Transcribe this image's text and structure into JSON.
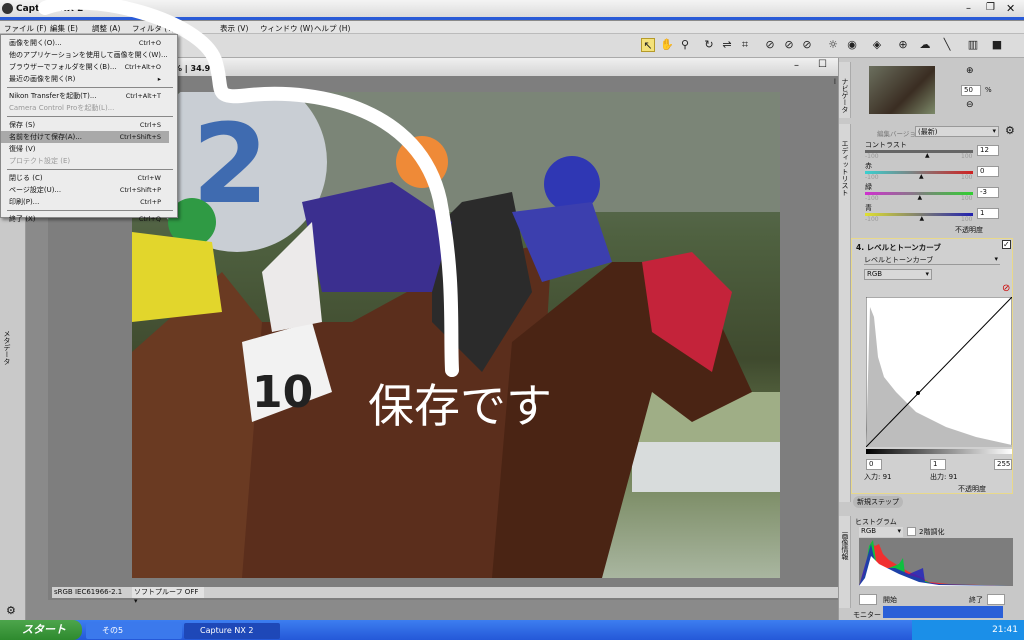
{
  "app": {
    "title": "Capture NX 2",
    "logo": "nx-logo-icon"
  },
  "menubar": [
    "ファイル (F)",
    "編集 (E)",
    "調整 (A)",
    "フィルタ (T)",
    "表示 (V)",
    "ウィンドウ (W)",
    "ヘルプ (H)"
  ],
  "file_menu": [
    {
      "label": "画像を開く(O)...",
      "shortcut": "Ctrl+O"
    },
    {
      "label": "他のアプリケーションを使用して画像を開く(W)...",
      "shortcut": ""
    },
    {
      "label": "ブラウザーでフォルダを開く(B)...",
      "shortcut": "Ctrl+Alt+O"
    },
    {
      "label": "最近の画像を開く(R)",
      "shortcut": "▸"
    },
    {
      "label": "Nikon Transferを起動(T)...",
      "shortcut": "Ctrl+Alt+T"
    },
    {
      "label": "Camera Control Proを起動(L)...",
      "shortcut": ""
    },
    {
      "label": "保存 (S)",
      "shortcut": "Ctrl+S"
    },
    {
      "label": "名前を付けて保存(A)...",
      "shortcut": "Ctrl+Shift+S"
    },
    {
      "label": "復帰 (V)",
      "shortcut": ""
    },
    {
      "label": "プロテクト設定 (E)",
      "shortcut": ""
    },
    {
      "label": "閉じる (C)",
      "shortcut": "Ctrl+W"
    },
    {
      "label": "ページ設定(U)...",
      "shortcut": "Ctrl+Shift+P"
    },
    {
      "label": "印刷(P)...",
      "shortcut": "Ctrl+P"
    },
    {
      "label": "終了 (X)",
      "shortcut": "Ctrl+Q"
    }
  ],
  "document": {
    "info": "% | 34.9MB",
    "color_profile": "sRGB IEC61966-2.1",
    "soft_proof": "ソフトプルーフ OFF"
  },
  "annotation": "保存です",
  "navigator": {
    "tab": "ナビゲーター",
    "zoom": "50",
    "unit": "%"
  },
  "edit_list": {
    "tab": "エディットリスト",
    "version_label": "編集バージョン",
    "version": "(最新)",
    "sliders": [
      {
        "label": "コントラスト",
        "value": "12",
        "min": "-100",
        "max": "100"
      },
      {
        "label": "赤",
        "value": "0",
        "min": "-100",
        "max": "100"
      },
      {
        "label": "緑",
        "value": "-3",
        "min": "-100",
        "max": "100"
      },
      {
        "label": "青",
        "value": "1",
        "min": "-100",
        "max": "100"
      }
    ],
    "opacity": "不透明度",
    "step_title": "4. レベルとトーンカーブ",
    "step_select": "レベルとトーンカーブ",
    "channel": "RGB",
    "black": "0",
    "gamma": "1",
    "white": "255",
    "input": "入力: 91",
    "output": "出力: 91",
    "new_step": "新規ステップ"
  },
  "histogram": {
    "tab": "画像情報",
    "title": "ヒストグラム",
    "channel": "RGB",
    "posterize": "2階調化",
    "start_label": "開始",
    "end_label": "終了"
  },
  "monitor": "モニター",
  "left_tab": "メタデータ",
  "taskbar": {
    "start": "スタート",
    "items": [
      "その5",
      "Capture NX 2"
    ],
    "clock": "21:41"
  },
  "colors": {
    "taskbar": "#2458d8",
    "start": "#3c9a3c",
    "highlight": "#a9a9a9"
  }
}
